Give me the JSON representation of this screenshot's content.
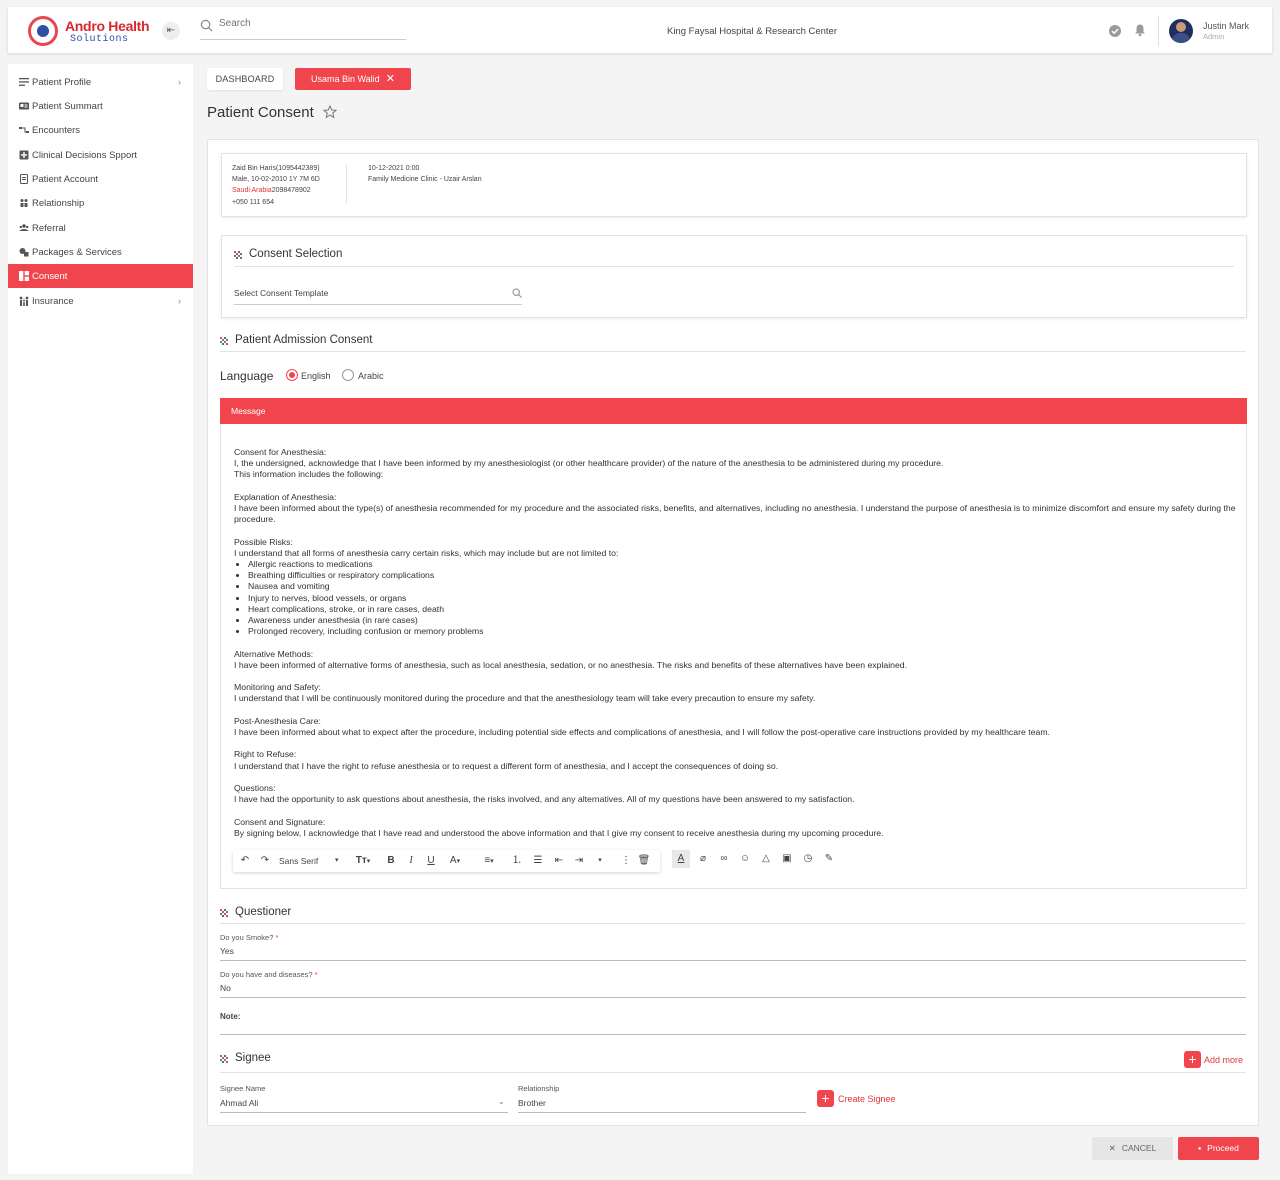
{
  "app": {
    "logo_title": "Andro Health",
    "logo_subtitle": "Solutions",
    "hospital": "King Faysal Hospital & Research Center",
    "search_placeholder": "Search",
    "user_name": "Justin Mark",
    "user_role": "Admin",
    "accent_color": "#f0454c"
  },
  "sidebar": {
    "items": [
      {
        "label": "Patient Profile",
        "icon": "list-icon",
        "has_children": true
      },
      {
        "label": "Patient Summart",
        "icon": "id-card-icon"
      },
      {
        "label": "Encounters",
        "icon": "flow-icon"
      },
      {
        "label": "Clinical Decisions Spport",
        "icon": "plus-box-icon"
      },
      {
        "label": "Patient Account",
        "icon": "document-icon"
      },
      {
        "label": "Relationship",
        "icon": "people-icon"
      },
      {
        "label": "Referral",
        "icon": "group-icon"
      },
      {
        "label": "Packages & Services",
        "icon": "packages-icon"
      },
      {
        "label": "Consent",
        "icon": "dashboard-icon",
        "active": true
      },
      {
        "label": "Insurance",
        "icon": "family-icon",
        "has_children": true
      }
    ]
  },
  "breadcrumb": {
    "dashboard": "DASHBOARD",
    "patient_tab": "Usama Bin Walid"
  },
  "page_title": "Patient Consent",
  "patient": {
    "name_id": "Zaid Bin Haris(1095442389)",
    "demographics": "Male, 10-02-2010 1Y 7M 6D",
    "country": "Saudi Arabia",
    "country_code": "2098478902",
    "phone": "+050 111 654",
    "visit_date": "10-12-2021 0:00",
    "clinic": "Family Medicine Clinic - Uzair Arslan"
  },
  "consent_selection": {
    "title": "Consent Selection",
    "placeholder": "Select Consent Template"
  },
  "admission_consent": {
    "title": "Patient Admission Consent",
    "language_label": "Language",
    "languages": [
      {
        "label": "English",
        "selected": true
      },
      {
        "label": "Arabic",
        "selected": false
      }
    ],
    "message_header": "Message",
    "message": {
      "sections": [
        {
          "heading": "Consent for Anesthesia:",
          "lines": [
            "I, the undersigned, acknowledge that I have been informed by my anesthesiologist (or other healthcare provider) of the nature of the anesthesia to be administered during my procedure.",
            "This information includes the following:"
          ]
        },
        {
          "heading": "Explanation of Anesthesia:",
          "lines": [
            "I have been informed about the type(s) of anesthesia recommended for my procedure and the associated risks, benefits, and alternatives, including no anesthesia. I understand the purpose of anesthesia is to minimize discomfort and ensure my safety during the procedure."
          ]
        },
        {
          "heading": "Possible Risks:",
          "lines": [
            "I understand that all forms of anesthesia carry certain risks, which may include but are not limited to:"
          ],
          "bullets": [
            "Allergic reactions to medications",
            "Breathing difficulties or respiratory complications",
            "Nausea and vomiting",
            "Injury to nerves, blood vessels, or organs",
            "Heart complications, stroke, or in rare cases, death",
            "Awareness under anesthesia (in rare cases)",
            "Prolonged recovery, including confusion or memory problems"
          ]
        },
        {
          "heading": "Alternative Methods:",
          "lines": [
            "I have been informed of alternative forms of anesthesia, such as local anesthesia, sedation, or no anesthesia. The risks and benefits of these alternatives have been explained."
          ]
        },
        {
          "heading": "Monitoring and Safety:",
          "lines": [
            "I understand that I will be continuously monitored during the procedure and that the anesthesiology team will take every precaution to ensure my safety."
          ]
        },
        {
          "heading": "Post-Anesthesia Care:",
          "lines": [
            "I have been informed about what to expect after the procedure, including potential side effects and complications of anesthesia, and I will follow the post-operative care instructions provided by my healthcare team."
          ]
        },
        {
          "heading": "Right to Refuse:",
          "lines": [
            "I understand that I have the right to refuse anesthesia or to request a different form of anesthesia, and I accept the consequences of doing so."
          ]
        },
        {
          "heading": "Questions:",
          "lines": [
            "I have had the opportunity to ask questions about anesthesia, the risks involved, and any alternatives. All of my questions have been answered to my satisfaction."
          ]
        },
        {
          "heading": "Consent and Signature:",
          "lines": [
            "By signing below, I acknowledge that I have read and understood the above information and that I give my consent to receive anesthesia during my upcoming procedure."
          ]
        }
      ]
    },
    "editor": {
      "font": "Sans Serif"
    }
  },
  "questioner": {
    "title": "Questioner",
    "questions": [
      {
        "label": "Do you Smoke?",
        "required": "*",
        "answer": "Yes"
      },
      {
        "label": "Do you have and diseases?",
        "required": "*",
        "answer": "No"
      }
    ],
    "note_label": "Note:"
  },
  "signee": {
    "title": "Signee",
    "add_more": "Add more",
    "name_label": "Signee Name",
    "name_value": "Ahmad Ali",
    "relationship_label": "Relationship",
    "relationship_value": "Brother",
    "create_label": "Create Signee"
  },
  "footer": {
    "cancel": "CANCEL",
    "proceed": "Proceed"
  }
}
